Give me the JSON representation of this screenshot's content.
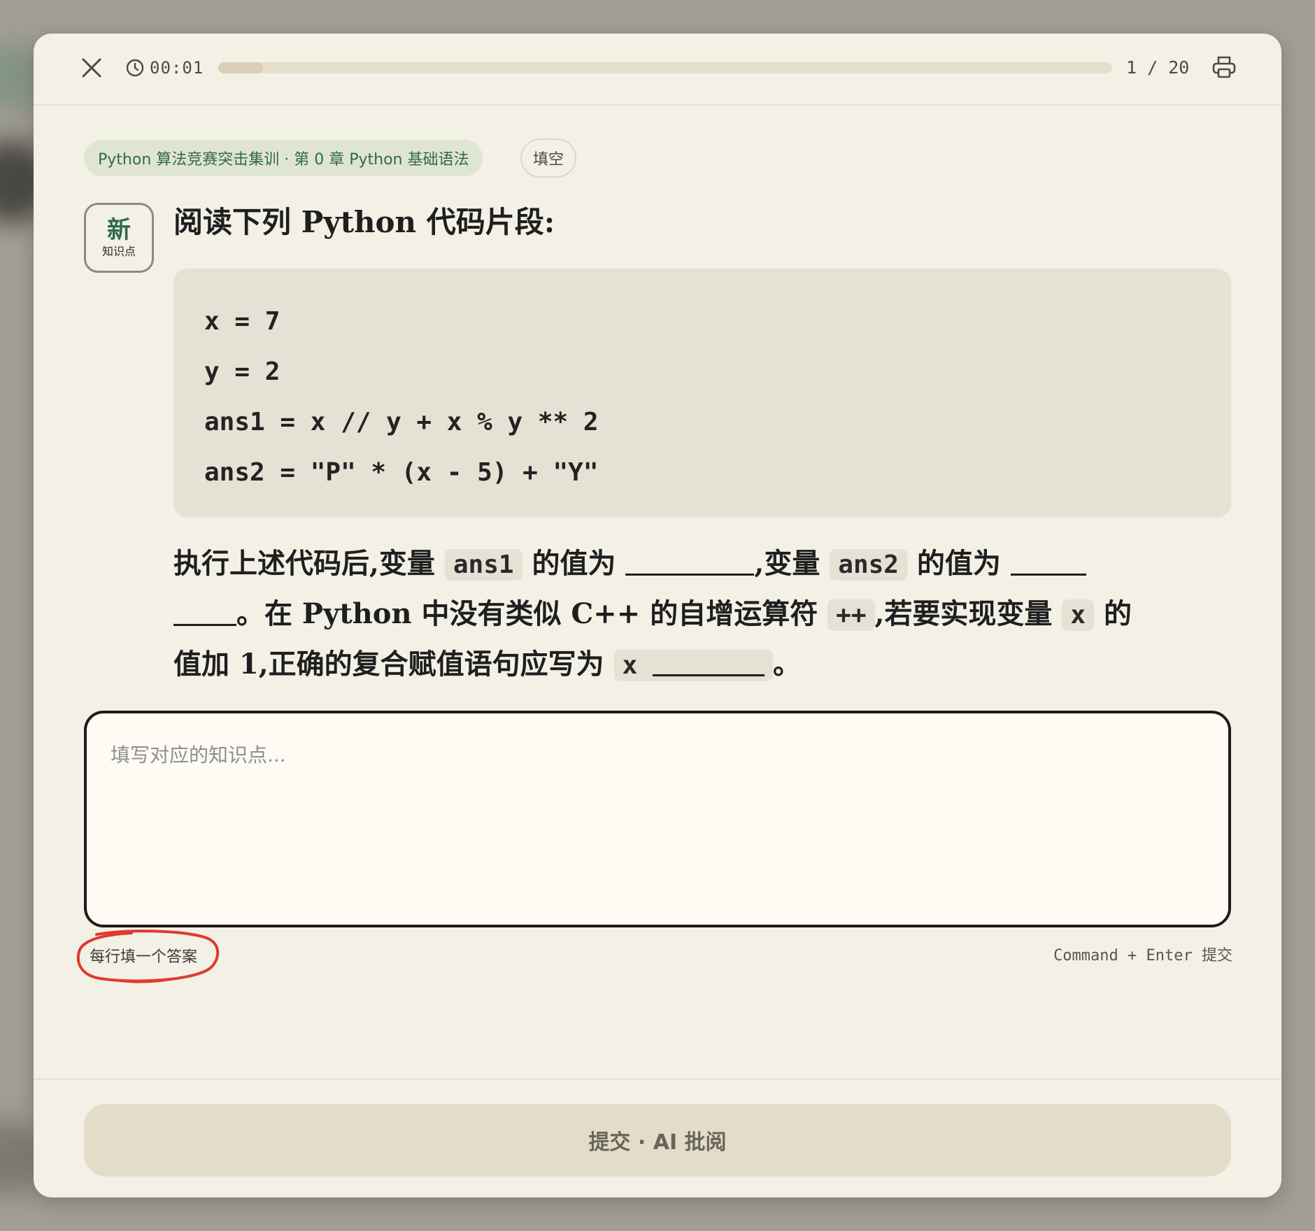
{
  "topbar": {
    "timer": "00:01",
    "progress_fraction": 0.05,
    "page_count": "1 / 20"
  },
  "tags": {
    "course": "Python 算法竞赛突击集训 · 第 0 章 Python 基础语法",
    "type": "填空"
  },
  "badge": {
    "big": "新",
    "small": "知识点"
  },
  "question": {
    "title": "阅读下列 Python 代码片段:",
    "code": [
      "x = 7",
      "y = 2",
      "ans1 = x // y + x % y ** 2",
      "ans2 = \"P\" * (x - 5) + \"Y\""
    ],
    "line1": {
      "t1": "执行上述代码后,变量 ",
      "c1": "ans1",
      "t2": " 的值为 ",
      "t3": ",变量 ",
      "c2": "ans2",
      "t4": " 的值为 "
    },
    "line2": {
      "t1": "。在 Python 中没有类似 C++ 的自增运算符 ",
      "c1": "++",
      "t2": ",若要实现变量 ",
      "c2": "x",
      "t3": " 的"
    },
    "line3": {
      "t1": "值加 1,正确的复合赋值语句应写为 ",
      "c1": "x",
      "t2": "。"
    }
  },
  "answer": {
    "placeholder": "填写对应的知识点..."
  },
  "hints": {
    "left": "每行填一个答案",
    "right": "Command + Enter 提交"
  },
  "submit": {
    "label": "提交 · AI 批阅"
  },
  "colors": {
    "accent_green": "#2f6b4b",
    "annotation_red": "#e03a2f"
  }
}
